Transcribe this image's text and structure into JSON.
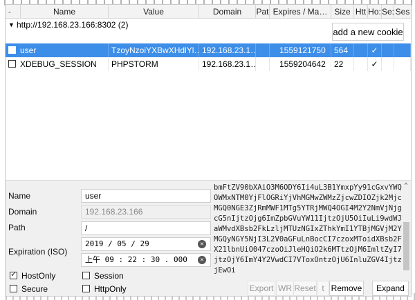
{
  "table": {
    "columns": [
      "-",
      "Name",
      "Value",
      "Domain",
      "Pat",
      "Expires / Ma…",
      "Size",
      "Htt",
      "Ho:",
      "Se:",
      "Ses"
    ],
    "group": {
      "title": "http://192.168.23.166:8302 (2)",
      "add_button": "add a new cookie"
    },
    "rows": [
      {
        "name": "user",
        "value": "TzoyNzoiYXBwXHdlYl…",
        "domain": "192.168.23.1…",
        "path": "",
        "expires": "1559121750",
        "size": "564",
        "httponly": "",
        "hostonly": "✓"
      },
      {
        "name": "XDEBUG_SESSION",
        "value": "PHPSTORM",
        "domain": "192.168.23.1…",
        "path": "",
        "expires": "1559204642",
        "size": "22",
        "httponly": "",
        "hostonly": "✓"
      }
    ]
  },
  "details": {
    "name_label": "Name",
    "name_value": "user",
    "domain_label": "Domain",
    "domain_value": "192.168.23.166",
    "path_label": "Path",
    "path_value": "/",
    "expiration_label": "Expiration (ISO)",
    "date_value": "2019 / 05 / 29",
    "time_value": "上午 09 : 22 : 30 . 000",
    "hostonly_label": "HostOnly",
    "session_label": "Session",
    "secure_label": "Secure",
    "httponly_label": "HttpOnly",
    "value_text": "bmFtZV90bXAiO3M6ODY6Ii4uL3B1YmxpYy91cGxvYWQvOWMxNTM0YjFlOGRiYjVhMGMwZWMzZjcwZDIOZjk2MjcvMGQ0NGE3ZjRmMWF1MTg5YTRjMWQ4OGI4M2Y2NmVjNjgucG5nIjtzOjg6ImZpbGVuYW11IjtzOjU5OiIuLi9wdWJsaWMvdXBsb2FkLzljMTUzNGIxZThkYmI1YTBjMGVjM2Y3MGQyNGY5NjI3L2V0aGFuLnBocCI7czoxMToidXBsb2FkX21lbnUiO047czoOiJleHQiO2k6MTtzOjM6ImltZyI7TjtzOjY6ImY4Y2VwdCI7VToxOntzOjU6InluZGV4IjtzOjEwOi",
    "buttons": {
      "export": "Export",
      "import": "WR",
      "reset": "Reset",
      "tail": "t",
      "remove": "Remove",
      "expand": "Expand"
    }
  },
  "icons": {
    "clear": "clear-circle-icon",
    "scroll_up": "chevron-up-icon"
  },
  "colors": {
    "selected_row": "#3d8ee8",
    "panel_bg": "#f0f0f0"
  }
}
